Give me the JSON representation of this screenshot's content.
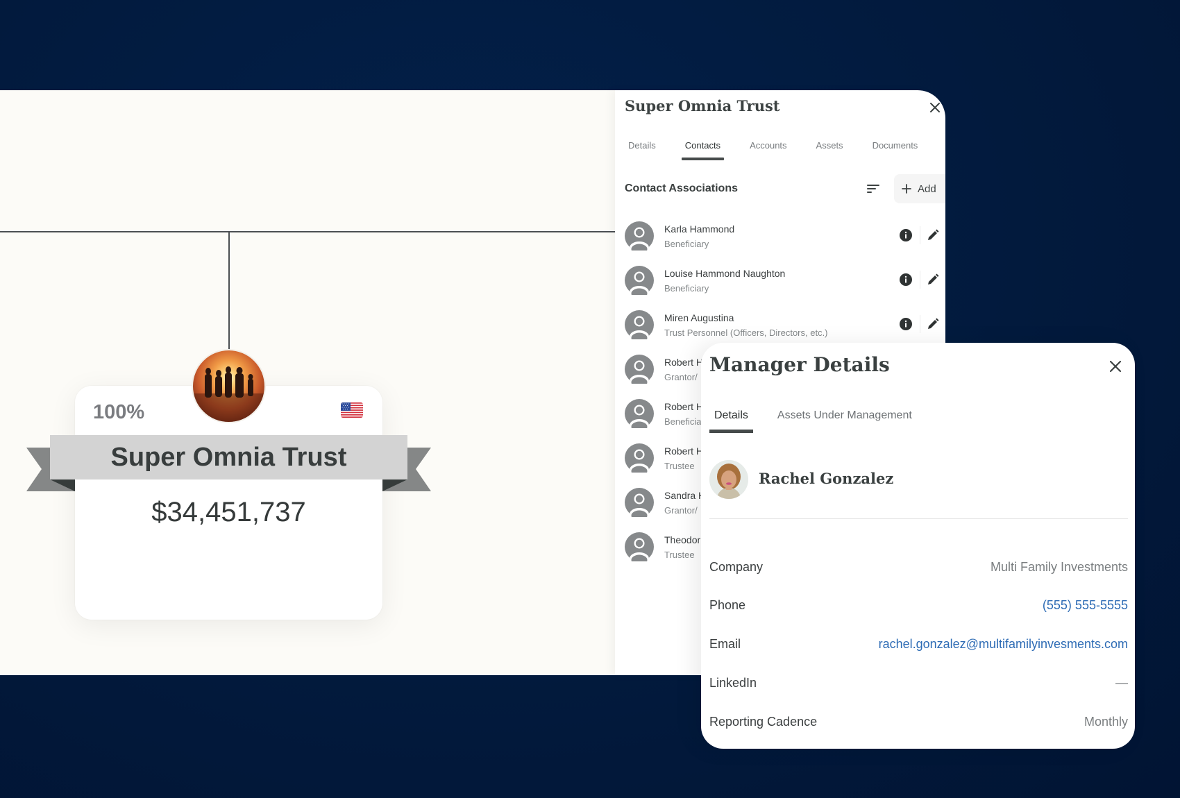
{
  "org_chart": {
    "node": {
      "ownership_percent": "100%",
      "country_flag": "us-flag-icon",
      "name": "Super Omnia Trust",
      "value": "$34,451,737",
      "photo": "family-sunset-photo"
    }
  },
  "contacts_panel": {
    "title": "Super Omnia Trust",
    "close_icon": "close-icon",
    "tabs": [
      {
        "label": "Details",
        "active": false
      },
      {
        "label": "Contacts",
        "active": true
      },
      {
        "label": "Accounts",
        "active": false
      },
      {
        "label": "Assets",
        "active": false
      },
      {
        "label": "Documents",
        "active": false
      }
    ],
    "section_title": "Contact Associations",
    "sort_icon": "sort-icon",
    "add_label": "Add",
    "contacts": [
      {
        "name": "Karla Hammond",
        "role": "Beneficiary"
      },
      {
        "name": "Louise Hammond Naughton",
        "role": "Beneficiary"
      },
      {
        "name": "Miren Augustina",
        "role": "Trust Personnel (Officers, Directors, etc.)"
      },
      {
        "name": "Robert H",
        "role": "Grantor/"
      },
      {
        "name": "Robert H",
        "role": "Beneficia"
      },
      {
        "name": "Robert H",
        "role": "Trustee"
      },
      {
        "name": "Sandra H",
        "role": "Grantor/"
      },
      {
        "name": "Theodor",
        "role": "Trustee"
      }
    ]
  },
  "manager_details": {
    "title": "Manager Details",
    "tabs": [
      {
        "label": "Details",
        "active": true
      },
      {
        "label": "Assets Under Management",
        "active": false
      }
    ],
    "name": "Rachel Gonzalez",
    "fields": [
      {
        "label": "Company",
        "value": "Multi Family Investments",
        "link": false
      },
      {
        "label": "Phone",
        "value": "(555) 555-5555",
        "link": true
      },
      {
        "label": "Email",
        "value": "rachel.gonzalez@multifamilyinvesments.com",
        "link": true
      },
      {
        "label": "LinkedIn",
        "value": "—",
        "link": false
      },
      {
        "label": "Reporting Cadence",
        "value": "Monthly",
        "link": false
      }
    ]
  },
  "colors": {
    "background": "#021a3d",
    "canvas": "#fcfbf7",
    "link": "#2e6cb5",
    "ribbon": "#d3d3d3",
    "ribbon_tail": "#858787",
    "ribbon_fold": "#363c3b"
  }
}
